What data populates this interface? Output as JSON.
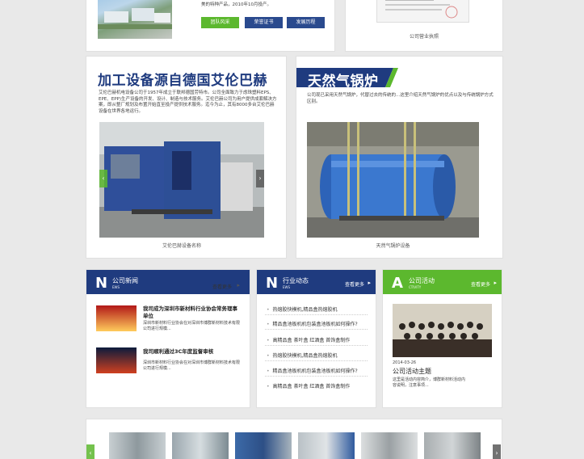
{
  "top": {
    "intro_text_line": "美的特种产品，2010年10月投产。",
    "btn_team": "团队风采",
    "btn_honor": "荣誉证书",
    "btn_history": "发展历程",
    "license_caption": "公司营业执照"
  },
  "card_left": {
    "title": "加工设备源自德国艾伦巴赫",
    "body": "艾伦巴赫机电设备公司于1957年成立于联邦德国劳特市。公司全面致力于虑珠塑料EPS、EPE、EPP)生产设备的开发、设计、制造与技术服务。艾伦巴赫公司为用户提供成套解决方案，即从整厂规划及布置开始直至投产提供技术服务。迄今为止，其有8000多台艾伦巴赫设备在世界各地运行。",
    "caption": "艾伦巴赫设备名称",
    "prev": "‹",
    "next": "›"
  },
  "card_right": {
    "title": "天然气锅炉",
    "body": "公司现已采用天然气锅炉，代替过去的传统的...这里介绍天然气锅炉的优点以及与传统锅炉方式区别。",
    "caption": "天然气锅炉设备"
  },
  "panels": {
    "news": {
      "letter": "N",
      "name": "公司新闻",
      "sub": "EWS",
      "more": "查看更多",
      "items": [
        {
          "title": "我司成为深圳市新材料行业协会常务理事单位",
          "desc": "深圳市新材料行业协会在对深圳市博群新材料技术有限公司进行规模..."
        },
        {
          "title": "我司顺利通过3C年度监督审核",
          "desc": "深圳市新材料行业协会在对深圳市博群新材料技术有限公司进行规模..."
        }
      ]
    },
    "industry": {
      "letter": "N",
      "name": "行业动态",
      "sub": "EWS",
      "more": "查看更多",
      "items": [
        "热熔胶快模机,精品盒热熔胶机",
        "精品盒池板机机包装盒池板机如何操作?",
        "高精品盒 茶叶盒 红酒盒 首饰盒制作",
        "热熔胶快模机,精品盒热熔胶机",
        "精品盒池板机机包装盒池板机如何操作?",
        "高精品盒 茶叶盒 红酒盒 首饰盒制作"
      ]
    },
    "activity": {
      "letter": "A",
      "name": "公司活动",
      "sub": "CTIVITY",
      "more": "查看更多",
      "date": "2014-03-26",
      "title": "公司活动主题",
      "desc": "这里是活动内容简介，博群新材料活动内容说明，注意事项..."
    }
  },
  "gallery": {
    "prev": "‹",
    "next": "›"
  },
  "colors": {
    "navy": "#1f3b7f",
    "green": "#5cb82e",
    "blue_btn": "#2a4a8e"
  }
}
